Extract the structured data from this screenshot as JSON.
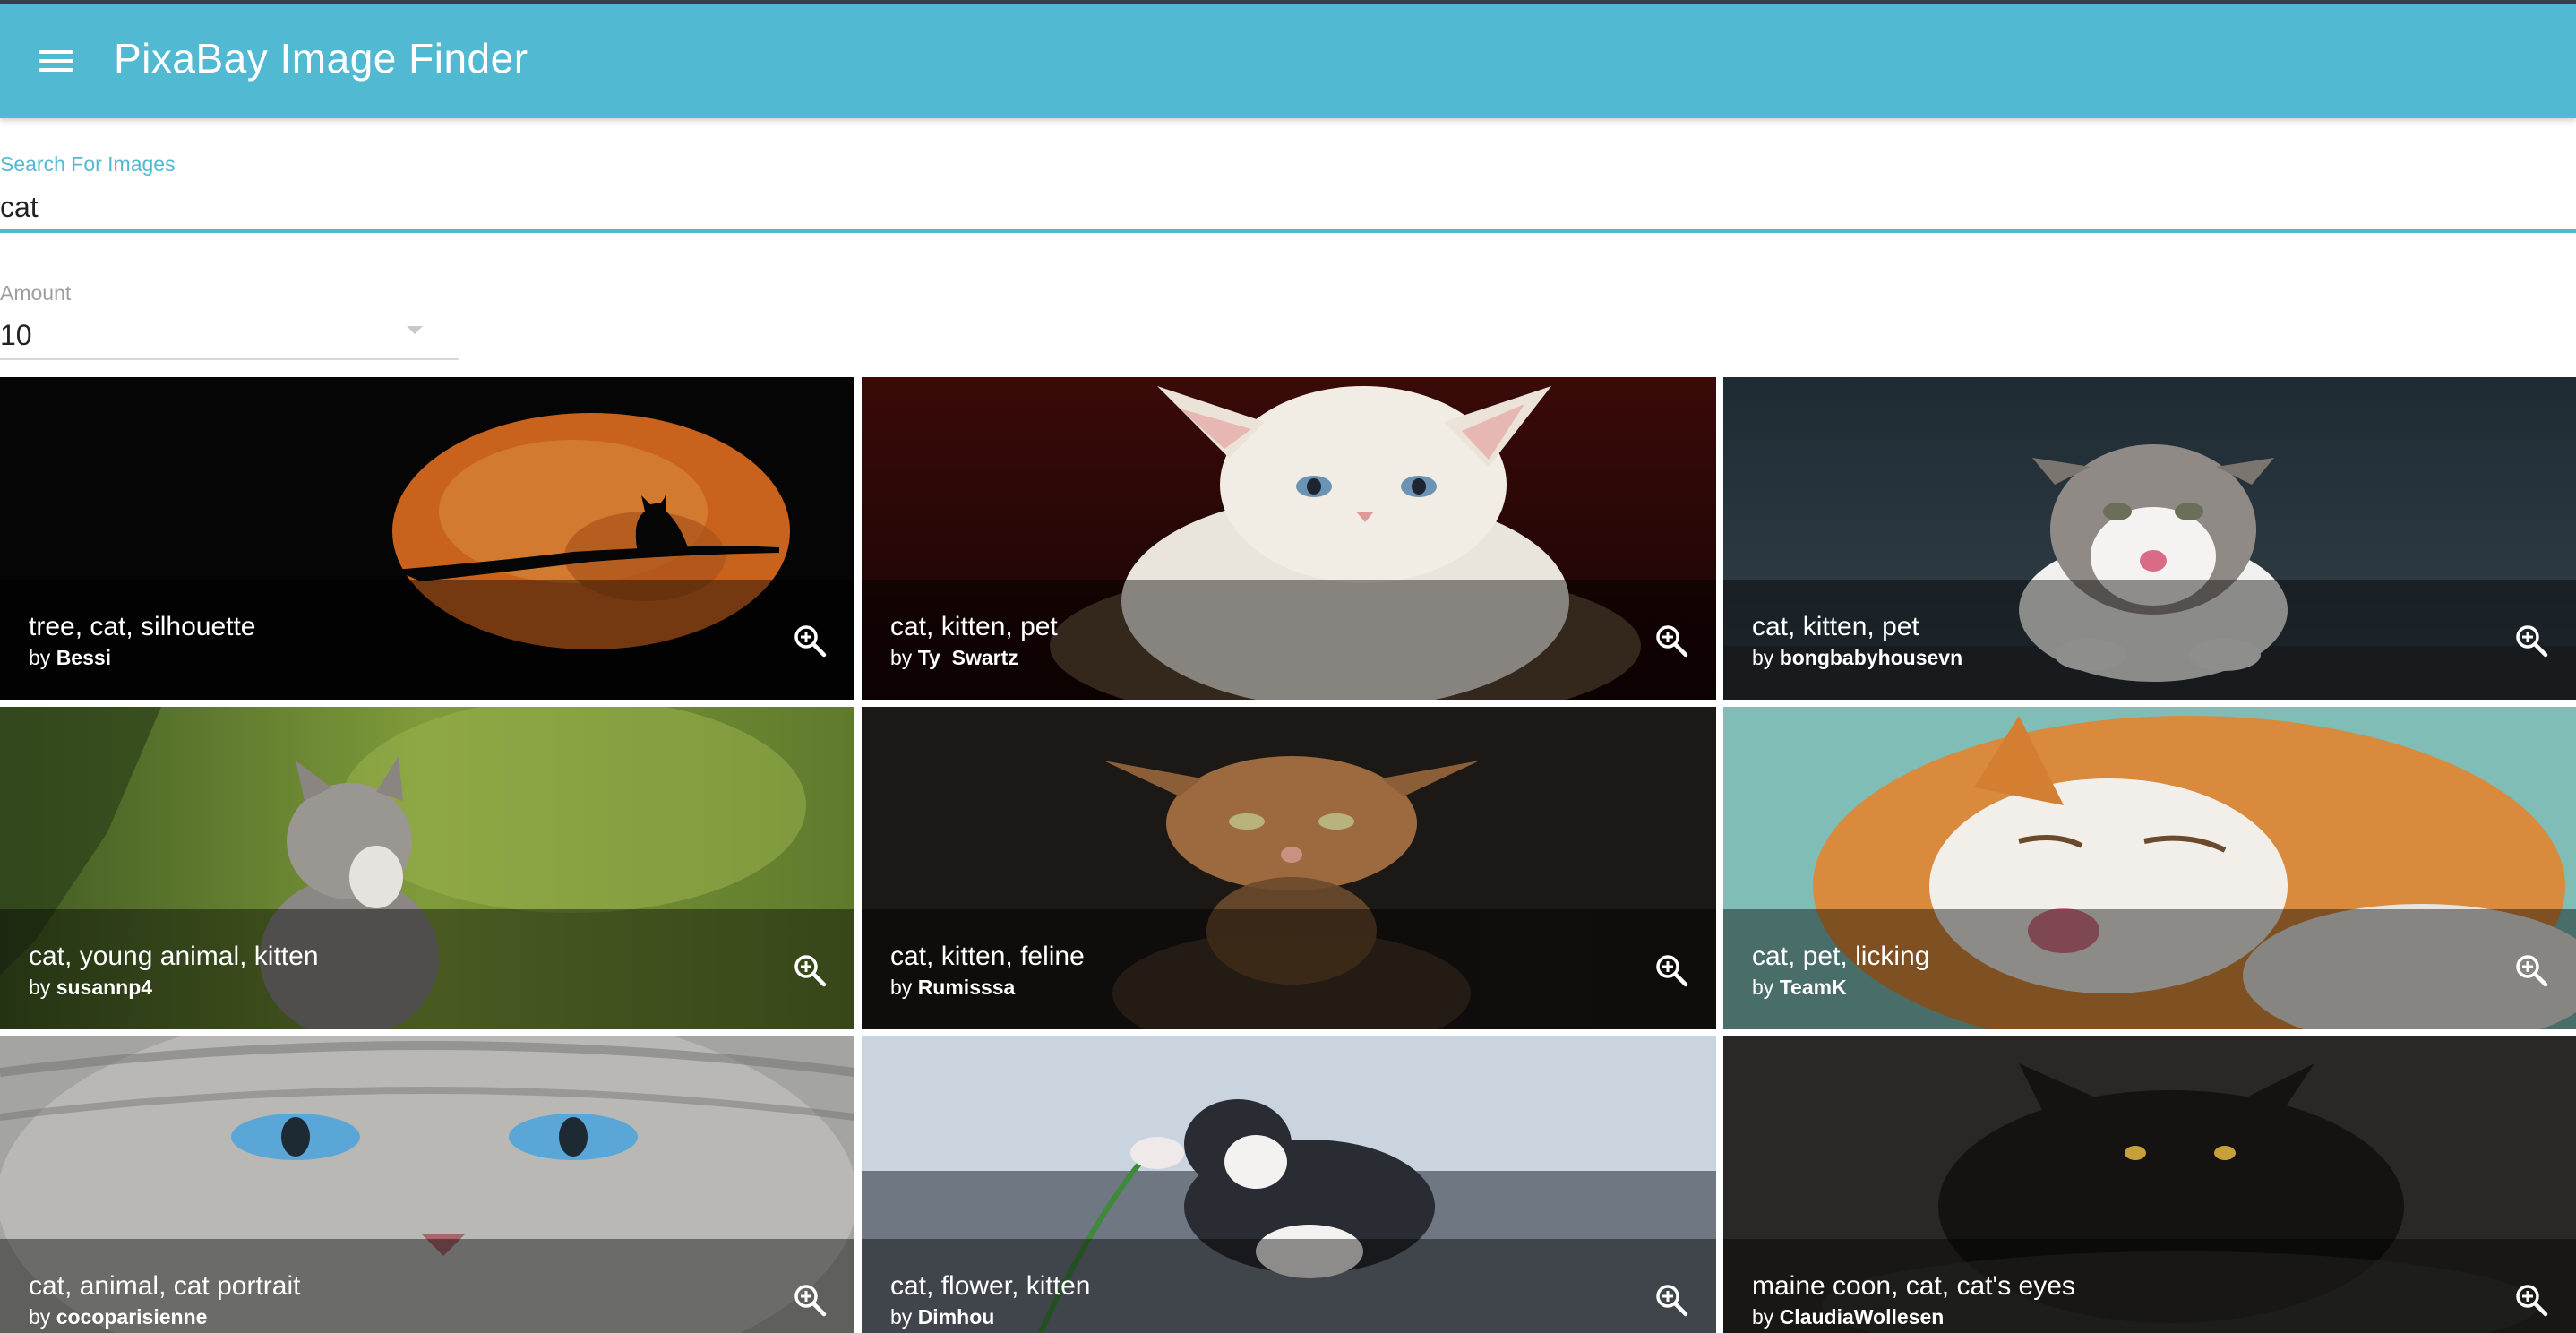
{
  "app": {
    "title": "PixaBay Image Finder",
    "menu_icon": "menu-icon",
    "accent_color": "#52b9d2"
  },
  "search": {
    "label": "Search For Images",
    "value": "cat"
  },
  "amount": {
    "label": "Amount",
    "value": "10"
  },
  "results": [
    {
      "tags": "tree, cat, silhouette",
      "by": "by",
      "user": "Bessi",
      "zoom_icon": "zoom-in-icon"
    },
    {
      "tags": "cat, kitten, pet",
      "by": "by",
      "user": "Ty_Swartz",
      "zoom_icon": "zoom-in-icon"
    },
    {
      "tags": "cat, kitten, pet",
      "by": "by",
      "user": "bongbabyhousevn",
      "zoom_icon": "zoom-in-icon"
    },
    {
      "tags": "cat, young animal, kitten",
      "by": "by",
      "user": "susannp4",
      "zoom_icon": "zoom-in-icon"
    },
    {
      "tags": "cat, kitten, feline",
      "by": "by",
      "user": "Rumisssa",
      "zoom_icon": "zoom-in-icon"
    },
    {
      "tags": "cat, pet, licking",
      "by": "by",
      "user": "TeamK",
      "zoom_icon": "zoom-in-icon"
    },
    {
      "tags": "cat, animal, cat portrait",
      "by": "by",
      "user": "cocoparisienne",
      "zoom_icon": "zoom-in-icon"
    },
    {
      "tags": "cat, flower, kitten",
      "by": "by",
      "user": "Dimhou",
      "zoom_icon": "zoom-in-icon"
    },
    {
      "tags": "maine coon, cat, cat's eyes",
      "by": "by",
      "user": "ClaudiaWollesen",
      "zoom_icon": "zoom-in-icon"
    }
  ]
}
